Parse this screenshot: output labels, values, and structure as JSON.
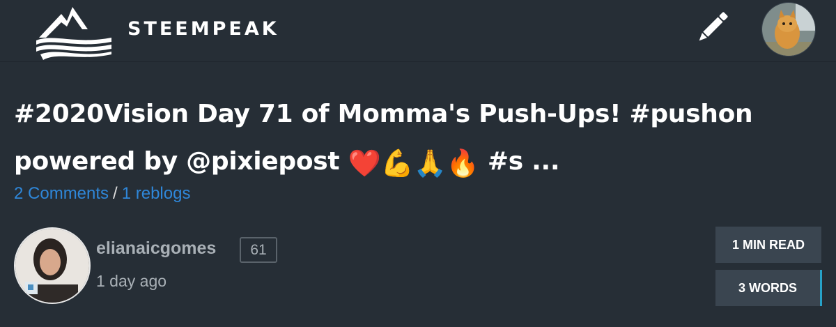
{
  "header": {
    "brand": "STEEMPEAK",
    "edit_icon": "pencil-icon",
    "logo_icon": "mountain-waves-logo"
  },
  "post": {
    "title_line1": "#2020Vision Day 71 of Momma's Push-Ups! #pushon",
    "title_line2_text": "powered by @pixiepost",
    "title_emojis": [
      "❤️",
      "💪",
      "🙏",
      "🔥"
    ],
    "title_tail": "#s ...",
    "comments_label": "2 Comments",
    "separator": "/",
    "reblogs_label": "1 reblogs"
  },
  "author": {
    "name": "elianaicgomes",
    "reputation": "61",
    "time": "1 day ago"
  },
  "stats": {
    "read_time": "1 MIN READ",
    "word_count": "3 WORDS"
  },
  "colors": {
    "background": "#262e36",
    "link": "#2f87d9",
    "muted": "#a9b0b6",
    "stat_bg": "#3a4550",
    "accent": "#27a2c8"
  }
}
